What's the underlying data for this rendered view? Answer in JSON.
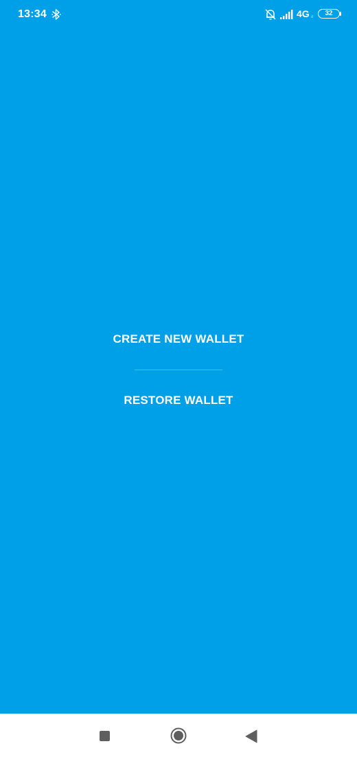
{
  "status_bar": {
    "time": "13:34",
    "network_type": "4G",
    "network_sub": "ıl",
    "battery_level": "32",
    "icons": [
      "bluetooth-icon",
      "mute-icon",
      "signal-icon",
      "battery-icon"
    ]
  },
  "menu": {
    "create_label": "CREATE NEW WALLET",
    "restore_label": "RESTORE WALLET"
  },
  "nav_bar": {
    "icons": [
      "recents-icon",
      "home-icon",
      "back-icon"
    ]
  },
  "colors": {
    "background": "#00a0e9",
    "text": "#ffffff",
    "nav_background": "#ffffff",
    "nav_icons": "#5f5f5f"
  }
}
